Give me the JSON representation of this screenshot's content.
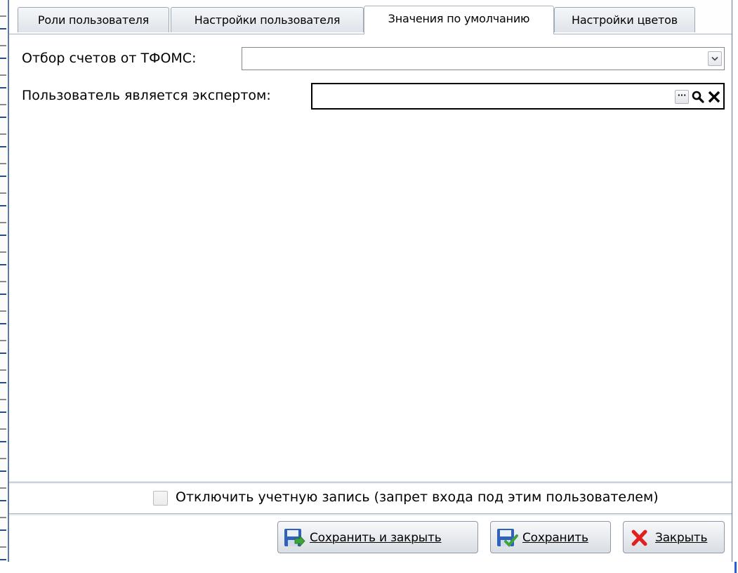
{
  "tabs": [
    {
      "label": "Роли пользователя",
      "active": false
    },
    {
      "label": "Настройки пользователя",
      "active": false
    },
    {
      "label": "Значения по умолчанию",
      "active": true
    },
    {
      "label": "Настройки цветов",
      "active": false
    }
  ],
  "form": {
    "tfoms_label": "Отбор счетов от ТФОМС:",
    "tfoms_value": "",
    "expert_label": "Пользователь является экспертом:",
    "expert_value": "",
    "lookup_dots": "···"
  },
  "disable_account": {
    "label": "Отключить учетную запись (запрет входа под этим пользователем)",
    "checked": false
  },
  "buttons": {
    "save_close": "Сохранить и закрыть",
    "save": "Сохранить",
    "close": "Закрыть"
  },
  "colors": {
    "window_border": "#5a7cad",
    "save_icon_blue": "#2f62b8",
    "save_arrow_green": "#3ea43a",
    "close_red": "#e02020"
  },
  "icons": [
    "chevron-down-icon",
    "ellipsis-icon",
    "search-icon",
    "clear-icon",
    "save-close-icon",
    "save-icon",
    "close-icon"
  ]
}
